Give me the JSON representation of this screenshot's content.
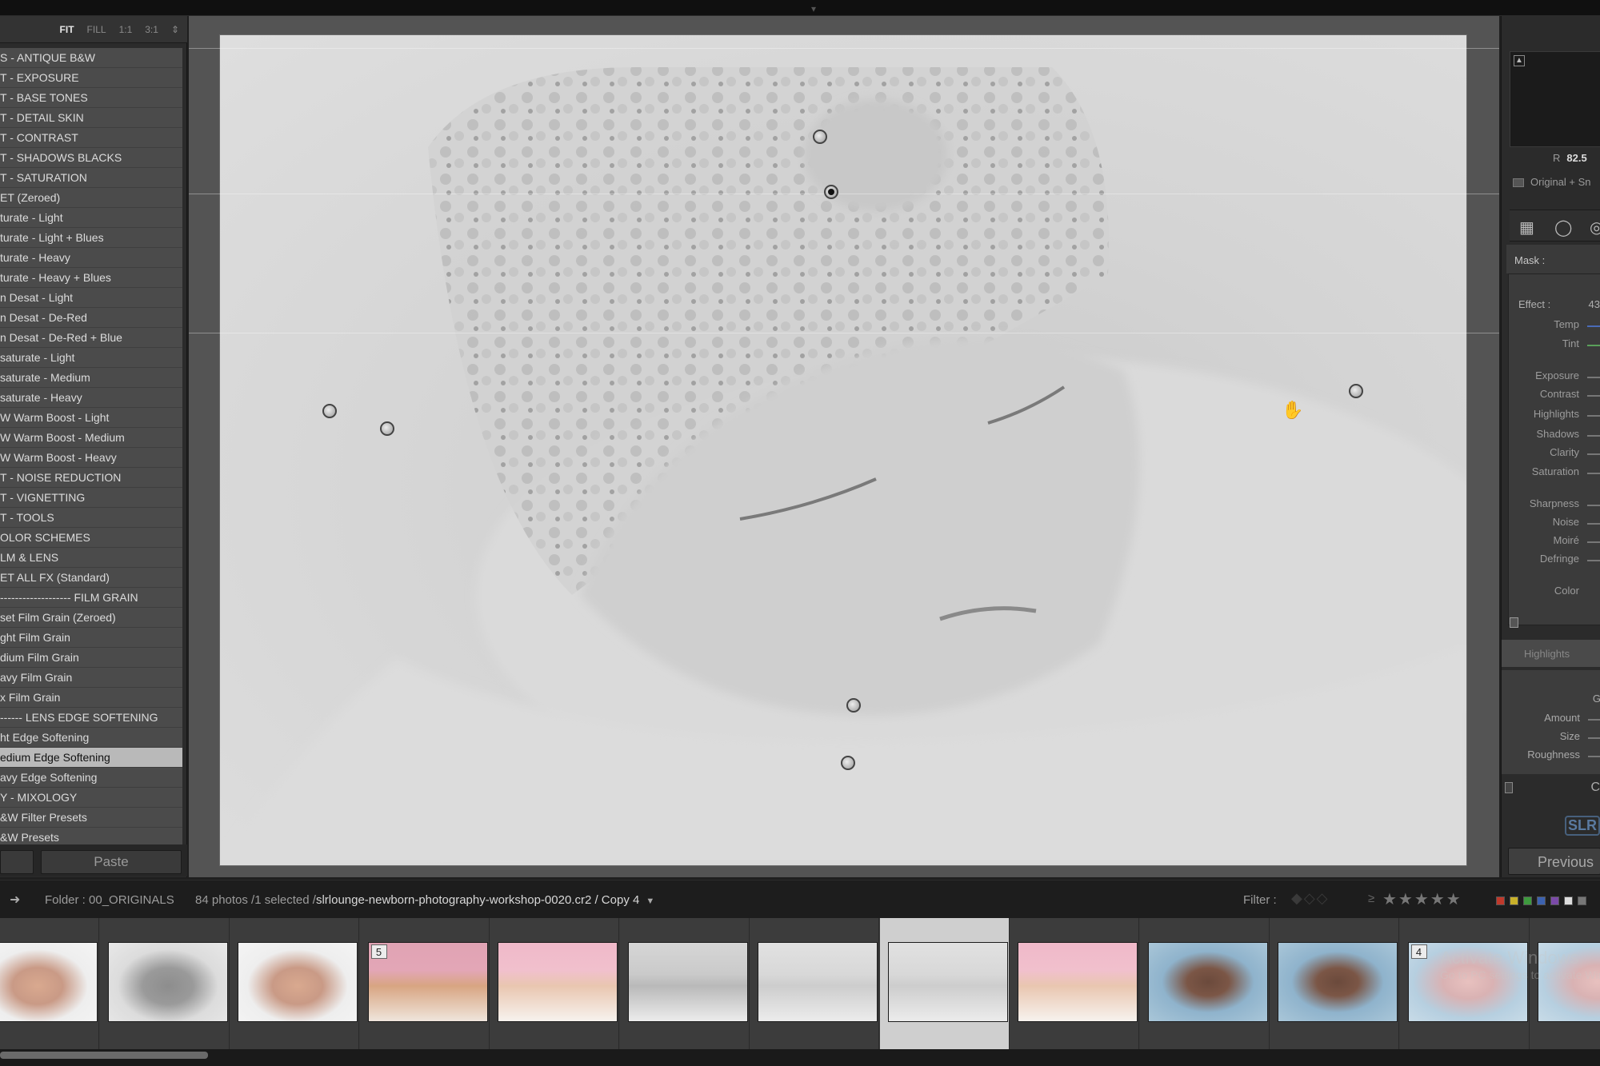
{
  "navigator": {
    "zoom_options": [
      "FIT",
      "FILL",
      "1:1",
      "3:1"
    ],
    "active_zoom": "FIT",
    "zoom_arrow": "⇕"
  },
  "presets": [
    "S - ANTIQUE B&W",
    "T - EXPOSURE",
    "T - BASE TONES",
    "T - DETAIL SKIN",
    "T - CONTRAST",
    "T - SHADOWS BLACKS",
    "T - SATURATION",
    "ET (Zeroed)",
    "turate - Light",
    "turate - Light + Blues",
    "turate - Heavy",
    "turate - Heavy + Blues",
    "n Desat - Light",
    "n Desat - De-Red",
    "n Desat - De-Red + Blue",
    "saturate - Light",
    "saturate - Medium",
    "saturate - Heavy",
    "W Warm Boost - Light",
    "W Warm Boost - Medium",
    "W Warm Boost - Heavy",
    "T - NOISE REDUCTION",
    "T - VIGNETTING",
    "T - TOOLS",
    "OLOR SCHEMES",
    "LM & LENS",
    "ET ALL FX (Standard)",
    "------------------- FILM GRAIN",
    "set Film Grain (Zeroed)",
    "ght Film Grain",
    "dium Film Grain",
    "avy Film Grain",
    "x Film Grain",
    "------ LENS EDGE SOFTENING",
    "ht Edge Softening",
    "edium Edge Softening",
    "avy Edge Softening",
    "Y - MIXOLOGY",
    "&W Filter Presets",
    "&W Presets"
  ],
  "selected_preset_index": 35,
  "left_footer": {
    "paste_label": "Paste"
  },
  "histogram": {
    "clip_symbol": "▲",
    "channel_label": "R",
    "channel_value": "82.5"
  },
  "view_mode_label": "Original + Sn",
  "mask": {
    "label": "Mask :"
  },
  "adjustments": {
    "effect_label": "Effect :",
    "effect_value": "43",
    "items": [
      "Temp",
      "Tint",
      "Exposure",
      "Contrast",
      "Highlights",
      "Shadows",
      "Clarity",
      "Saturation",
      "Sharpness",
      "Noise",
      "Moiré",
      "Defringe",
      "Color"
    ]
  },
  "grain": {
    "header": "Highlights",
    "letter": "G",
    "items": [
      "Amount",
      "Size",
      "Roughness"
    ]
  },
  "right_misc_letter": "C",
  "logo_text": "SLR",
  "previous_label": "Previous",
  "info_bar": {
    "arrow_icon": "➜",
    "folder": "Folder : 00_ORIGINALS",
    "count": "84 photos /1 selected /",
    "filename": "slrlounge-newborn-photography-workshop-0020.cr2 / Copy 4",
    "filename_arrow": "▼",
    "filter_label": "Filter :",
    "flags": "◆◇◇",
    "stars_prefix": "≥",
    "stars": "★★★★★",
    "color_labels": [
      "#c0392b",
      "#c9b12a",
      "#3e9a3e",
      "#3c62b0",
      "#7b4aa8",
      "#dddddd",
      "#777777"
    ]
  },
  "filmstrip": {
    "selected_index": 7,
    "items": [
      {
        "badge": "",
        "tone": "color-baby"
      },
      {
        "badge": "",
        "tone": "bw"
      },
      {
        "badge": "",
        "tone": "color-baby"
      },
      {
        "badge": "5",
        "tone": "pink-hat"
      },
      {
        "badge": "",
        "tone": "pink-hat-light"
      },
      {
        "badge": "",
        "tone": "bw-hat"
      },
      {
        "badge": "",
        "tone": "bw-hat-faded"
      },
      {
        "badge": "",
        "tone": "bw-hat-faded"
      },
      {
        "badge": "",
        "tone": "pink-hat-light"
      },
      {
        "badge": "",
        "tone": "blue-blanket"
      },
      {
        "badge": "",
        "tone": "blue-blanket"
      },
      {
        "badge": "4",
        "tone": "pink-blue"
      },
      {
        "badge": "",
        "tone": "pink-blue"
      }
    ]
  },
  "watermark": {
    "title": "Activate Windows",
    "subtitle": "Go to PC settings to activate Windows."
  }
}
